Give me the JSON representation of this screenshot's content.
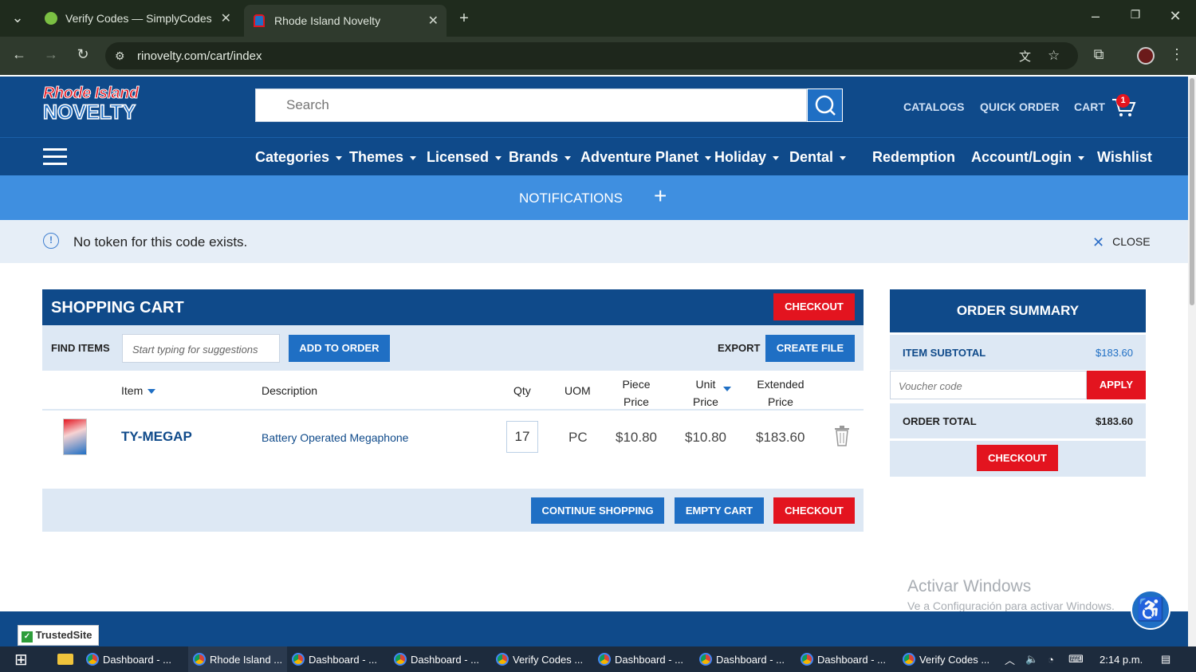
{
  "browser": {
    "tabs": [
      {
        "label": "Verify Codes — SimplyCodes",
        "active": false
      },
      {
        "label": "Rhode Island Novelty",
        "active": true
      }
    ],
    "url": "rinovelty.com/cart/index"
  },
  "header": {
    "logo_line1": "Rhode Island",
    "logo_line2": "NOVELTY",
    "search_placeholder": "Search",
    "links": [
      "CATALOGS",
      "QUICK ORDER",
      "CART"
    ],
    "cart_count": "1"
  },
  "nav": {
    "items": [
      "Categories",
      "Themes",
      "Licensed",
      "Brands",
      "Adventure Planet",
      "Holiday",
      "Dental",
      "Redemption",
      "Account/Login",
      "Wishlist"
    ]
  },
  "notifications": {
    "label": "NOTIFICATIONS"
  },
  "alert": {
    "message": "No token for this code exists.",
    "close": "CLOSE"
  },
  "cart": {
    "title": "SHOPPING CART",
    "checkout": "CHECKOUT",
    "find_items": "FIND ITEMS",
    "find_placeholder": "Start typing for suggestions",
    "add_to_order": "ADD TO ORDER",
    "export": "EXPORT",
    "create_file": "CREATE FILE",
    "columns": {
      "item": "Item",
      "description": "Description",
      "qty": "Qty",
      "uom": "UOM",
      "piece_price_1": "Piece",
      "piece_price_2": "Price",
      "unit_price_1": "Unit",
      "unit_price_2": "Price",
      "ext_price_1": "Extended",
      "ext_price_2": "Price"
    },
    "rows": [
      {
        "item": "TY-MEGAP",
        "description": "Battery Operated Megaphone",
        "qty": "17",
        "uom": "PC",
        "piece_price": "$10.80",
        "unit_price": "$10.80",
        "extended_price": "$183.60"
      }
    ],
    "continue_shopping": "CONTINUE SHOPPING",
    "empty_cart": "EMPTY CART"
  },
  "summary": {
    "title": "ORDER SUMMARY",
    "subtotal_label": "ITEM SUBTOTAL",
    "subtotal_value": "$183.60",
    "voucher_placeholder": "Voucher code",
    "apply": "APPLY",
    "total_label": "ORDER TOTAL",
    "total_value": "$183.60",
    "checkout": "CHECKOUT"
  },
  "watermark": {
    "line1": "Activar Windows",
    "line2": "Ve a Configuración para activar Windows."
  },
  "trusted": "TrustedSite",
  "taskbar": {
    "items": [
      "Dashboard - ...",
      "Rhode Island ...",
      "Dashboard - ...",
      "Dashboard - ...",
      "Verify Codes ...",
      "Dashboard - ...",
      "Dashboard - ...",
      "Dashboard - ...",
      "Verify Codes ..."
    ],
    "time": "2:14 p.m."
  },
  "colors": {
    "brand": "#0f4a8a",
    "accent": "#1f6fc4",
    "danger": "#e3141f",
    "light": "#dde8f4"
  }
}
